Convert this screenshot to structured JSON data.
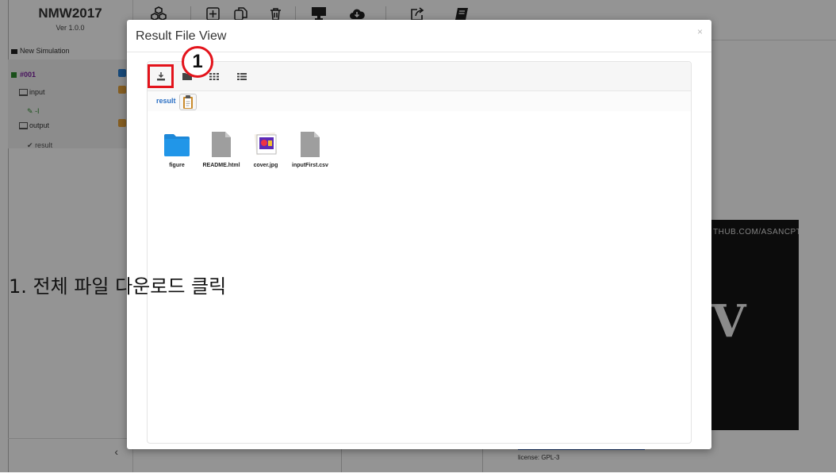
{
  "app": {
    "title": "NMW2017",
    "version": "Ver 1.0.0"
  },
  "sidebar": {
    "new_simulation": "New Simulation",
    "item_id": "#001",
    "input_label": "input",
    "edit_marker": "-I",
    "output_label": "output",
    "result_label": "result",
    "collapse_icon": "chevron-left-icon"
  },
  "background": {
    "image_text_top": "THUB.COM/ASANCPT",
    "image_text_big": "V",
    "license": "license: GPL-3"
  },
  "modal": {
    "title": "Result File View",
    "close": "×",
    "breadcrumb": "result",
    "files": [
      {
        "name": "figure",
        "type": "folder"
      },
      {
        "name": "README.html",
        "type": "file"
      },
      {
        "name": "cover.jpg",
        "type": "image"
      },
      {
        "name": "inputFirst.csv",
        "type": "file"
      }
    ]
  },
  "annotation": {
    "badge": "1",
    "instruction": "1. 전체 파일 다운로드 클릭"
  },
  "colors": {
    "highlight": "#e3131b",
    "folder": "#1e88d8",
    "link": "#2a6fc4",
    "active_item": "#7a1fa0"
  }
}
